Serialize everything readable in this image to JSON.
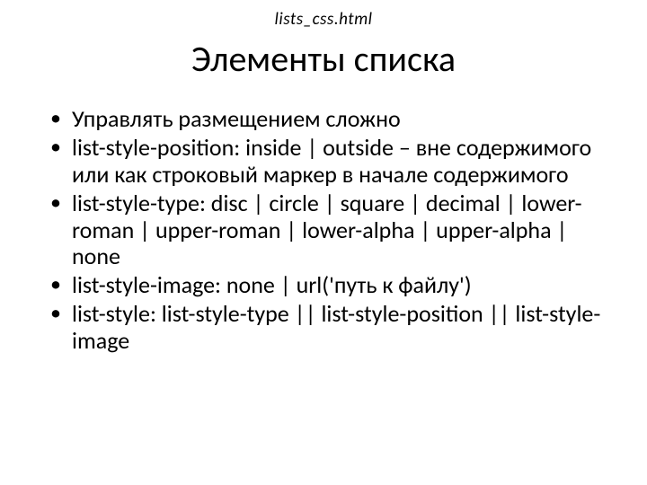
{
  "header": {
    "filename": "lists_css.html",
    "title": "Элементы списка"
  },
  "bullets": {
    "items": [
      "Управлять размещением сложно",
      "list-style-position: inside | outside – вне содержимого или как строковый маркер в начале содержимого",
      "list-style-type: disc | circle | square | decimal | lower-roman | upper-roman | lower-alpha | upper-alpha | none",
      "list-style-image: none | url('путь к файлу')",
      "list-style: list-style-type || list-style-position || list-style-image"
    ]
  }
}
